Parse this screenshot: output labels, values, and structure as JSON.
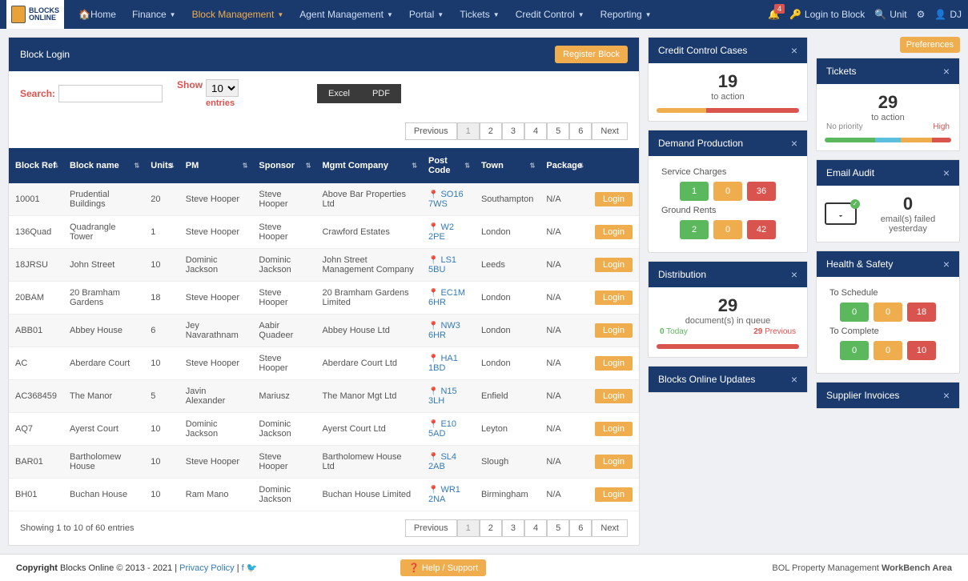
{
  "brand": {
    "line1": "BLOCKS",
    "line2": "ONLINE"
  },
  "nav": {
    "items": [
      {
        "label": "Home",
        "icon": "home-icon",
        "active": false,
        "dd": false
      },
      {
        "label": "Finance",
        "active": false,
        "dd": true
      },
      {
        "label": "Block Management",
        "active": true,
        "dd": true
      },
      {
        "label": "Agent Management",
        "active": false,
        "dd": true
      },
      {
        "label": "Portal",
        "active": false,
        "dd": true
      },
      {
        "label": "Tickets",
        "active": false,
        "dd": true
      },
      {
        "label": "Credit Control",
        "active": false,
        "dd": true
      },
      {
        "label": "Reporting",
        "active": false,
        "dd": true
      }
    ],
    "alerts": "4",
    "login_block": "Login to Block",
    "unit": "Unit",
    "user": "DJ"
  },
  "block_login": {
    "title": "Block Login",
    "register_btn": "Register Block",
    "search_label": "Search:",
    "show_label": "Show",
    "show_value": "10",
    "entries_label": "entries",
    "export_excel": "Excel",
    "export_pdf": "PDF",
    "pager_prev": "Previous",
    "pager_next": "Next",
    "pager_pages": [
      "1",
      "2",
      "3",
      "4",
      "5",
      "6"
    ],
    "pager_active": "1",
    "columns": [
      "Block Ref",
      "Block name",
      "Units",
      "PM",
      "Sponsor",
      "Mgmt Company",
      "Post Code",
      "Town",
      "Package",
      ""
    ],
    "rows": [
      {
        "ref": "10001",
        "name": "Prudential Buildings",
        "units": "20",
        "pm": "Steve Hooper",
        "sponsor": "Steve Hooper",
        "mgmt": "Above Bar Properties Ltd",
        "pc": "SO16 7WS",
        "town": "Southampton",
        "pkg": "N/A"
      },
      {
        "ref": "136Quad",
        "name": "Quadrangle Tower",
        "units": "1",
        "pm": "Steve Hooper",
        "sponsor": "Steve Hooper",
        "mgmt": "Crawford Estates",
        "pc": "W2 2PE",
        "town": "London",
        "pkg": "N/A"
      },
      {
        "ref": "18JRSU",
        "name": "John Street",
        "units": "10",
        "pm": "Dominic Jackson",
        "sponsor": "Dominic Jackson",
        "mgmt": "John Street Management Company",
        "pc": "LS1 5BU",
        "town": "Leeds",
        "pkg": "N/A"
      },
      {
        "ref": "20BAM",
        "name": "20 Bramham Gardens",
        "units": "18",
        "pm": "Steve Hooper",
        "sponsor": "Steve Hooper",
        "mgmt": "20 Bramham Gardens Limited",
        "pc": "EC1M 6HR",
        "town": "London",
        "pkg": "N/A"
      },
      {
        "ref": "ABB01",
        "name": "Abbey House",
        "units": "6",
        "pm": "Jey Navarathnam",
        "sponsor": "Aabir Quadeer",
        "mgmt": "Abbey House Ltd",
        "pc": "NW3 6HR",
        "town": "London",
        "pkg": "N/A"
      },
      {
        "ref": "AC",
        "name": "Aberdare Court",
        "units": "10",
        "pm": "Steve Hooper",
        "sponsor": "Steve Hooper",
        "mgmt": "Aberdare Court Ltd",
        "pc": "HA1 1BD",
        "town": "London",
        "pkg": "N/A"
      },
      {
        "ref": "AC368459",
        "name": "The Manor",
        "units": "5",
        "pm": "Javin Alexander",
        "sponsor": "Mariusz",
        "mgmt": "The Manor Mgt Ltd",
        "pc": "N15 3LH",
        "town": "Enfield",
        "pkg": "N/A"
      },
      {
        "ref": "AQ7",
        "name": "Ayerst Court",
        "units": "10",
        "pm": "Dominic Jackson",
        "sponsor": "Dominic Jackson",
        "mgmt": "Ayerst Court Ltd",
        "pc": "E10 5AD",
        "town": "Leyton",
        "pkg": "N/A"
      },
      {
        "ref": "BAR01",
        "name": "Bartholomew House",
        "units": "10",
        "pm": "Steve Hooper",
        "sponsor": "Steve Hooper",
        "mgmt": "Bartholomew House Ltd",
        "pc": "SL4 2AB",
        "town": "Slough",
        "pkg": "N/A"
      },
      {
        "ref": "BH01",
        "name": "Buchan House",
        "units": "10",
        "pm": "Ram Mano",
        "sponsor": "Dominic Jackson",
        "mgmt": "Buchan House Limited",
        "pc": "WR1 2NA",
        "town": "Birmingham",
        "pkg": "N/A"
      }
    ],
    "login_btn": "Login",
    "info": "Showing 1 to 10 of 60 entries"
  },
  "widgets": {
    "preferences": "Preferences",
    "credit": {
      "title": "Credit Control Cases",
      "value": "19",
      "sub": "to action"
    },
    "tickets": {
      "title": "Tickets",
      "value": "29",
      "sub": "to action",
      "no_prio": "No priority",
      "high": "High"
    },
    "demand": {
      "title": "Demand Production",
      "sc_label": "Service Charges",
      "sc": [
        "1",
        "0",
        "36"
      ],
      "gr_label": "Ground Rents",
      "gr": [
        "2",
        "0",
        "42"
      ]
    },
    "email": {
      "title": "Email Audit",
      "value": "0",
      "sub": "email(s) failed yesterday"
    },
    "dist": {
      "title": "Distribution",
      "value": "29",
      "sub": "document(s) in queue",
      "today_n": "0",
      "today_l": "Today",
      "prev_n": "29",
      "prev_l": "Previous"
    },
    "hs": {
      "title": "Health & Safety",
      "sched_label": "To Schedule",
      "sched": [
        "0",
        "0",
        "18"
      ],
      "comp_label": "To Complete",
      "comp": [
        "0",
        "0",
        "10"
      ]
    },
    "updates": {
      "title": "Blocks Online Updates"
    },
    "supplier": {
      "title": "Supplier Invoices"
    }
  },
  "footer": {
    "copyright_bold": "Copyright",
    "copyright_rest": " Blocks Online © 2013 - 2021 | ",
    "privacy": "Privacy Policy",
    "help": "Help / Support",
    "wb_pre": "BOL Property Management ",
    "wb_bold": "WorkBench Area"
  }
}
